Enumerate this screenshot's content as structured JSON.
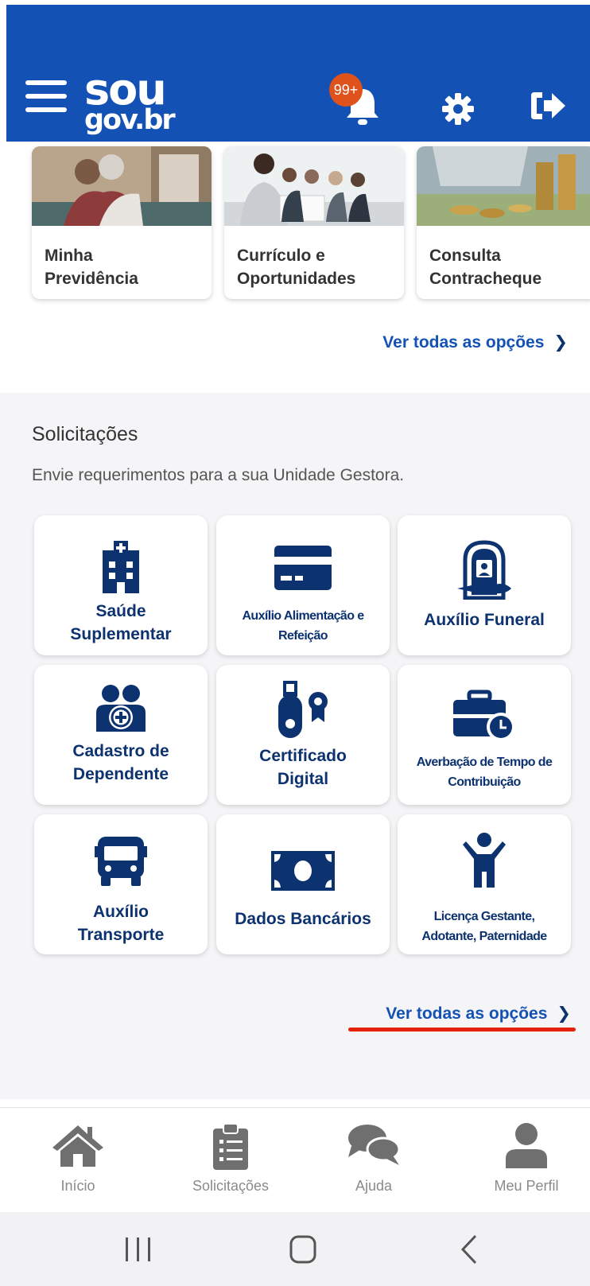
{
  "header": {
    "logo_line1": "sou",
    "logo_line2": "gov.br",
    "notification_badge": "99+",
    "icons": [
      "menu-icon",
      "bell-icon",
      "gear-icon",
      "logout-icon"
    ]
  },
  "featured_cards": [
    {
      "title": "Minha\nPrevidência"
    },
    {
      "title": "Currículo e\nOportunidades"
    },
    {
      "title": "Consulta\nContracheque"
    }
  ],
  "featured_link": "Ver todas as opções",
  "solicitacoes": {
    "title": "Solicitações",
    "subtitle": "Envie requerimentos para a sua Unidade Gestora.",
    "tiles": [
      {
        "label": "Saúde\nSuplementar",
        "icon": "hospital-icon"
      },
      {
        "label": "Auxílio Alimentação e\nRefeição",
        "icon": "credit-card-icon"
      },
      {
        "label": "Auxílio Funeral",
        "icon": "funeral-icon"
      },
      {
        "label": "Cadastro de\nDependente",
        "icon": "add-dependent-icon"
      },
      {
        "label": "Certificado\nDigital",
        "icon": "certificate-token-icon"
      },
      {
        "label": "Averbação de Tempo de\nContribuição",
        "icon": "briefcase-clock-icon"
      },
      {
        "label": "Auxílio\nTransporte",
        "icon": "bus-icon"
      },
      {
        "label": "Dados Bancários",
        "icon": "money-bill-icon"
      },
      {
        "label": "Licença Gestante,\nAdotante, Paternidade",
        "icon": "child-icon"
      }
    ],
    "link": "Ver todas as opções"
  },
  "bottom_nav": [
    {
      "label": "Início",
      "icon": "home-icon"
    },
    {
      "label": "Solicitações",
      "icon": "clipboard-icon"
    },
    {
      "label": "Ajuda",
      "icon": "chat-icon"
    },
    {
      "label": "Meu Perfil",
      "icon": "user-icon"
    }
  ],
  "colors": {
    "brand_blue": "#1351b4",
    "dark_blue": "#0c326f",
    "badge_orange": "#e0521c",
    "underline_red": "#e52207"
  }
}
